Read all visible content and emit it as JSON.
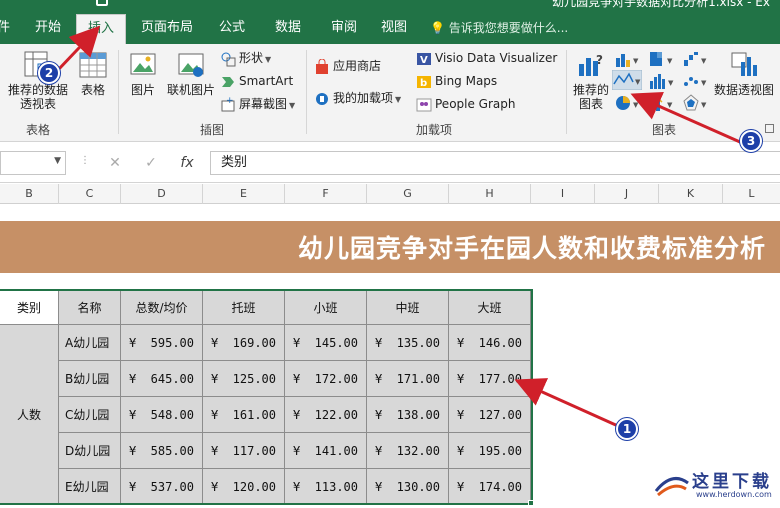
{
  "window": {
    "file_name": "幼儿园竞争对手数据对比分析1.xlsx - Ex"
  },
  "tabs": [
    {
      "label": "文件"
    },
    {
      "label": "开始"
    },
    {
      "label": "插入",
      "active": true
    },
    {
      "label": "页面布局"
    },
    {
      "label": "公式"
    },
    {
      "label": "数据"
    },
    {
      "label": "审阅"
    },
    {
      "label": "视图"
    }
  ],
  "tell_me": "告诉我您想要做什么...",
  "ribbon": {
    "tables_group": {
      "label": "表格",
      "recommended_pivot": "推荐的数据透视表",
      "table": "表格"
    },
    "illustrations_group": {
      "label": "插图",
      "pictures": "图片",
      "online_pictures": "联机图片",
      "shapes": "形状",
      "smartart": "SmartArt",
      "screenshot": "屏幕截图"
    },
    "addins_group": {
      "label": "加载项",
      "store": "应用商店",
      "my_addins": "我的加载项",
      "visio": "Visio Data Visualizer",
      "bing_maps": "Bing Maps",
      "people_graph": "People Graph"
    },
    "charts_group": {
      "label": "图表",
      "recommended_charts": "推荐的图表",
      "pivot_chart": "数据透视图"
    }
  },
  "formula_bar": {
    "name_box": "",
    "cancel": "✕",
    "enter": "✓",
    "fx": "fx",
    "content": "类别"
  },
  "columns": [
    "B",
    "C",
    "D",
    "E",
    "F",
    "G",
    "H",
    "I",
    "J",
    "K",
    "L"
  ],
  "sheet": {
    "banner_title": "幼儿园竞争对手在园人数和收费标准分析",
    "table": {
      "headers": [
        "类别",
        "名称",
        "总数/均价",
        "托班",
        "小班",
        "中班",
        "大班"
      ],
      "category": "人数",
      "currency": "¥",
      "rows": [
        {
          "name": "A幼儿园",
          "values": [
            "595.00",
            "169.00",
            "145.00",
            "135.00",
            "146.00"
          ]
        },
        {
          "name": "B幼儿园",
          "values": [
            "645.00",
            "125.00",
            "172.00",
            "171.00",
            "177.00"
          ]
        },
        {
          "name": "C幼儿园",
          "values": [
            "548.00",
            "161.00",
            "122.00",
            "138.00",
            "127.00"
          ]
        },
        {
          "name": "D幼儿园",
          "values": [
            "585.00",
            "117.00",
            "141.00",
            "132.00",
            "195.00"
          ]
        },
        {
          "name": "E幼儿园",
          "values": [
            "537.00",
            "120.00",
            "113.00",
            "130.00",
            "174.00"
          ]
        }
      ]
    }
  },
  "annotations": {
    "step1": "1",
    "step2": "2",
    "step3": "3",
    "arrow_color": "#d0202a",
    "badge_color": "#1d3fa8"
  },
  "watermark": {
    "text": "这里下载",
    "url": "www.herdown.com"
  },
  "colors": {
    "excel_green": "#217346",
    "banner": "#c69066",
    "cell_gray": "#d8d8d8"
  }
}
